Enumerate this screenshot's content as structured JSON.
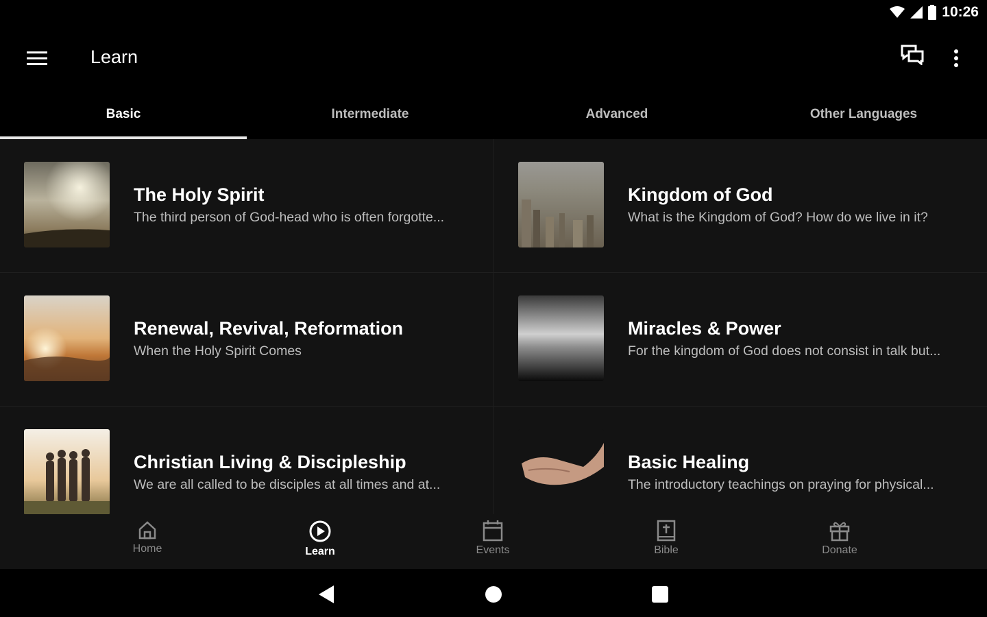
{
  "status_bar": {
    "time": "10:26"
  },
  "app_bar": {
    "title": "Learn"
  },
  "tabs": [
    {
      "label": "Basic",
      "active": true
    },
    {
      "label": "Intermediate",
      "active": false
    },
    {
      "label": "Advanced",
      "active": false
    },
    {
      "label": "Other Languages",
      "active": false
    }
  ],
  "courses": [
    {
      "title": "The Holy Spirit",
      "subtitle": "The third person of God-head who is often forgotte...",
      "image": "sky-clouds-image"
    },
    {
      "title": "Kingdom of God",
      "subtitle": "What is the Kingdom of God? How do we live in it?",
      "image": "city-aerial-image"
    },
    {
      "title": "Renewal, Revival, Reformation",
      "subtitle": "When the Holy Spirit Comes",
      "image": "sunset-image"
    },
    {
      "title": "Miracles & Power",
      "subtitle": "For the kingdom of God does not consist in talk but...",
      "image": "misty-sea-image"
    },
    {
      "title": "Christian Living & Discipleship",
      "subtitle": "We are all called to be disciples at all times and at...",
      "image": "group-of-friends-image"
    },
    {
      "title": "Basic Healing",
      "subtitle": "The introductory teachings on praying for physical...",
      "image": "open-hands-image"
    }
  ],
  "bottom_nav": [
    {
      "label": "Home",
      "icon": "home-icon",
      "active": false
    },
    {
      "label": "Learn",
      "icon": "play-circle-icon",
      "active": true
    },
    {
      "label": "Events",
      "icon": "calendar-icon",
      "active": false
    },
    {
      "label": "Bible",
      "icon": "bible-icon",
      "active": false
    },
    {
      "label": "Donate",
      "icon": "gift-icon",
      "active": false
    }
  ]
}
